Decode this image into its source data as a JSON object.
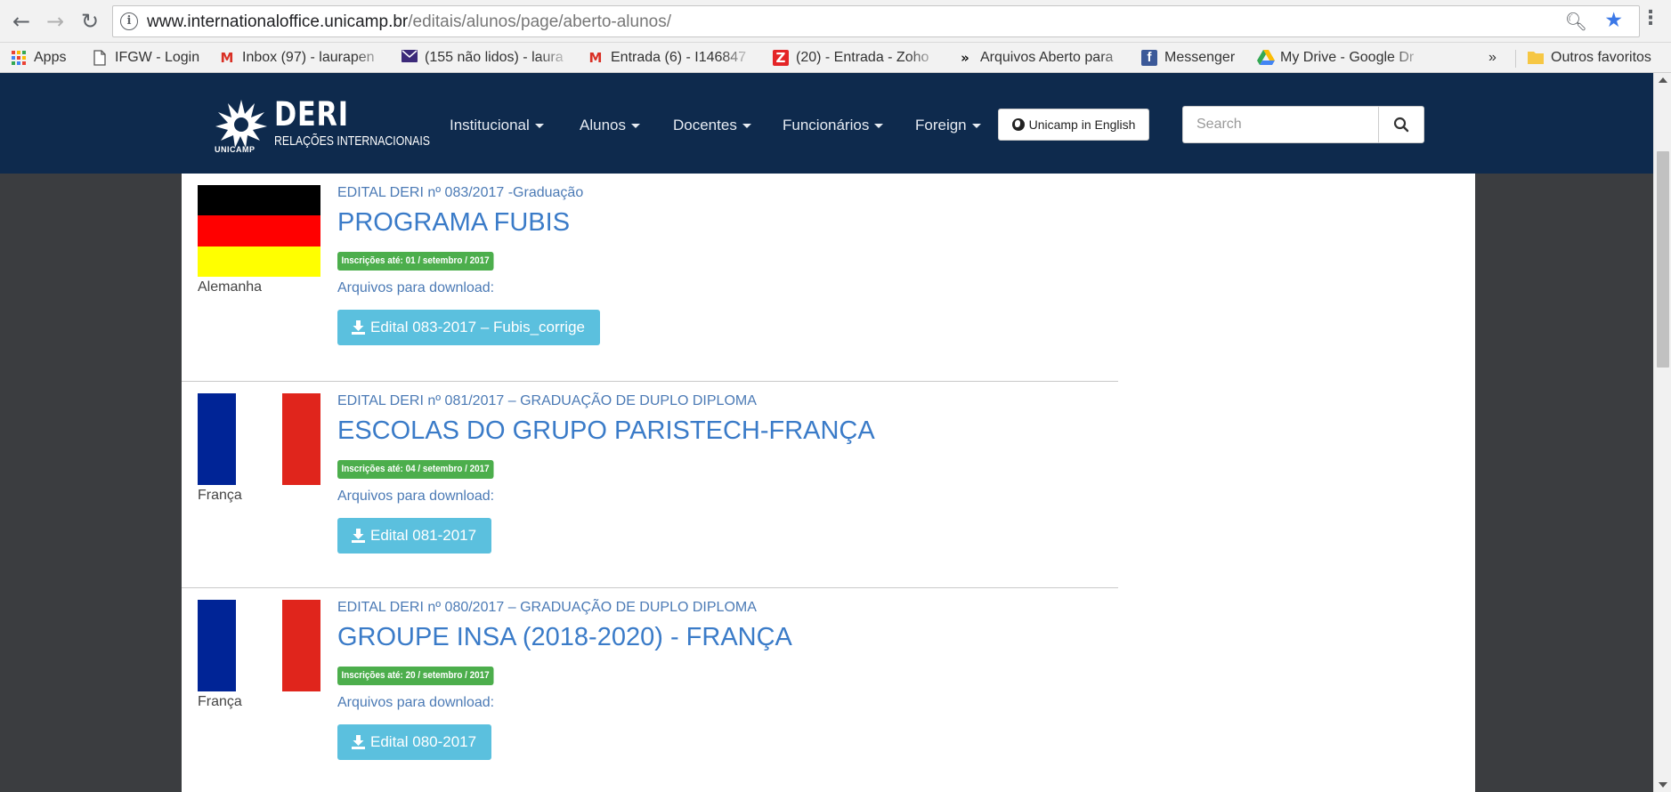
{
  "browser": {
    "url_domain": "www.internationaloffice.unicamp.br",
    "url_path": "/editais/alunos/page/aberto-alunos/",
    "bookmarks": [
      {
        "label": "Apps",
        "icon": "apps-grid-icon"
      },
      {
        "label": "IFGW - Login",
        "icon": "page-icon"
      },
      {
        "label": "Inbox (97) - laurapen",
        "icon": "gmail-icon"
      },
      {
        "label": "(155 não lidos) - laura",
        "icon": "mail-envelope-icon"
      },
      {
        "label": "Entrada (6) - I146847",
        "icon": "gmail-icon"
      },
      {
        "label": "(20) - Entrada - Zoho",
        "icon": "zoho-icon"
      },
      {
        "label": "Arquivos Aberto para",
        "icon": "double-chevron-icon"
      },
      {
        "label": "Messenger",
        "icon": "facebook-icon"
      },
      {
        "label": "My Drive - Google Dr",
        "icon": "google-drive-icon"
      }
    ],
    "overflow_label": "»",
    "other_bookmarks": "Outros favoritos"
  },
  "site": {
    "logo_title": "DERI",
    "logo_subtitle": "RELAÇÕES INTERNACIONAIS",
    "logo_small": "UNICAMP",
    "nav": [
      "Institucional",
      "Alunos",
      "Docentes",
      "Funcionários",
      "Foreign"
    ],
    "lang_button": "Unicamp in English",
    "search_placeholder": "Search"
  },
  "entries": [
    {
      "code": "EDITAL DERI nº 083/2017 -Graduação",
      "title": "PROGRAMA FUBIS",
      "deadline": "Inscrições até: 01 / setembro / 2017",
      "country": "Alemanha",
      "flag": "germany",
      "download_label": "Arquivos para download:",
      "download_button": "Edital 083-2017 – Fubis_corrige"
    },
    {
      "code": "EDITAL DERI nº 081/2017 – GRADUAÇÃO DE DUPLO DIPLOMA",
      "title": "ESCOLAS DO GRUPO PARISTECH-FRANÇA",
      "deadline": "Inscrições até: 04 / setembro / 2017",
      "country": "França",
      "flag": "france",
      "download_label": "Arquivos para download:",
      "download_button": "Edital 081-2017"
    },
    {
      "code": "EDITAL DERI nº 080/2017 – GRADUAÇÃO DE DUPLO DIPLOMA",
      "title": "GROUPE INSA (2018-2020) - FRANÇA",
      "deadline": "Inscrições até: 20 / setembro / 2017",
      "country": "França",
      "flag": "france",
      "download_label": "Arquivos para download:",
      "download_button": "Edital 080-2017"
    }
  ],
  "colors": {
    "header_bg": "#0e2a4d",
    "link_blue": "#3a7bc8",
    "deadline_green": "#4cae4c",
    "download_blue": "#5bc0de",
    "germany": [
      "#000000",
      "#ff0000",
      "#ffff00"
    ],
    "france": [
      "#002496",
      "#ffffff",
      "#e0251c"
    ]
  }
}
